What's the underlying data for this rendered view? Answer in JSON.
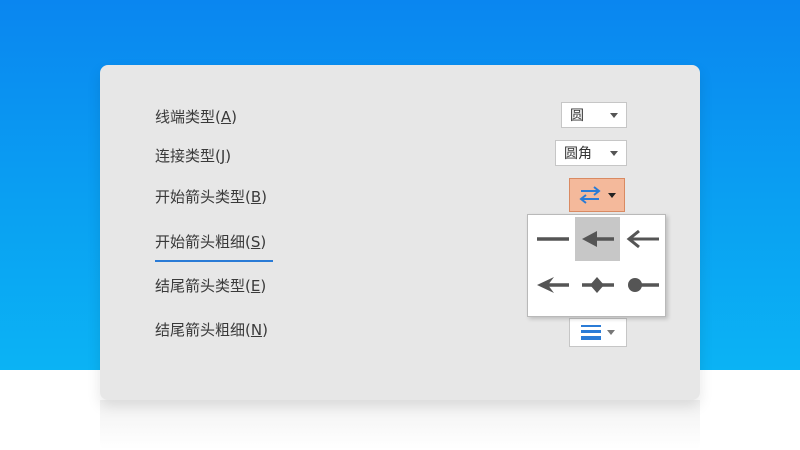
{
  "labels": {
    "cap_type": {
      "text": "线端类型(",
      "key": "A",
      "end": ")"
    },
    "join_type": {
      "text": "连接类型(",
      "key": "J",
      "end": ")"
    },
    "begin_arrow_type": {
      "text": "开始箭头类型(",
      "key": "B",
      "end": ")"
    },
    "begin_arrow_size": {
      "text": "开始箭头粗细(",
      "key": "S",
      "end": ")"
    },
    "end_arrow_type": {
      "text": "结尾箭头类型(",
      "key": "E",
      "end": ")"
    },
    "end_arrow_size": {
      "text": "结尾箭头粗细(",
      "key": "N",
      "end": ")"
    }
  },
  "controls": {
    "cap_type_value": "圆",
    "join_type_value": "圆角"
  },
  "arrow_styles": [
    {
      "id": "none",
      "selected": false
    },
    {
      "id": "arrow",
      "selected": true
    },
    {
      "id": "open-arrow",
      "selected": false
    },
    {
      "id": "stealth-arrow",
      "selected": false
    },
    {
      "id": "diamond-arrow",
      "selected": false
    },
    {
      "id": "oval-arrow",
      "selected": false
    }
  ],
  "colors": {
    "background_blue": "#0a86f0",
    "panel": "#e7e7e7",
    "active_button": "#f4b99b",
    "icon_blue": "#2a7bd6",
    "arrow_gray": "#555555",
    "selected_cell": "#c7c7c7"
  }
}
